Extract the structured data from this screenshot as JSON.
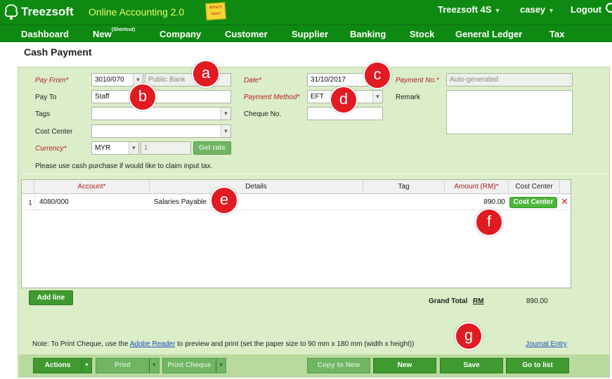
{
  "brand": {
    "logo_text": "Treezsoft",
    "app_name": "Online Accounting 2.0",
    "whats_new": "What's New!"
  },
  "user_menu": {
    "company": "Treezsoft 4S",
    "user": "casey",
    "logout": "Logout"
  },
  "nav": [
    {
      "label": "Dashboard"
    },
    {
      "label": "New",
      "sup": "(Shortcut)"
    },
    {
      "label": "Company"
    },
    {
      "label": "Customer"
    },
    {
      "label": "Supplier"
    },
    {
      "label": "Banking"
    },
    {
      "label": "Stock"
    },
    {
      "label": "General Ledger"
    },
    {
      "label": "Tax"
    }
  ],
  "page_title": "Cash Payment",
  "form": {
    "pay_from": {
      "label": "Pay From*",
      "code": "3010/070",
      "name": "Public Bank"
    },
    "pay_to": {
      "label": "Pay To",
      "value": "Staff"
    },
    "tags": {
      "label": "Tags",
      "value": ""
    },
    "cost_center": {
      "label": "Cost Center",
      "value": ""
    },
    "currency": {
      "label": "Currency*",
      "value": "MYR",
      "rate": "1",
      "get_rate": "Get rate"
    },
    "date": {
      "label": "Date*",
      "value": "31/10/2017"
    },
    "payment_method": {
      "label": "Payment Method*",
      "value": "EFT"
    },
    "cheque_no": {
      "label": "Cheque No.",
      "value": ""
    },
    "payment_no": {
      "label": "Payment No.*",
      "value": "Auto-generated"
    },
    "remark": {
      "label": "Remark",
      "value": ""
    },
    "note": "Please use cash purchase if would like to claim input tax."
  },
  "grid": {
    "headers": {
      "account": "Account*",
      "details": "Details",
      "tag": "Tag",
      "amount": "Amount (RM)*",
      "cost_center": "Cost Center"
    },
    "rows": [
      {
        "num": "1",
        "account": "4080/000",
        "details": "Salaries Payable",
        "tag": "",
        "amount": "890.00",
        "cost_center_btn": "Cost Center"
      }
    ]
  },
  "add_line": "Add line",
  "grand_total": {
    "label": "Grand Total",
    "currency": "RM",
    "value": "890.00"
  },
  "print_note": {
    "before": "Note: To Print Cheque, use the",
    "link": "Adobe Reader",
    "after": "to preview and print (set the paper size to 90 mm x 180 mm (width x height))"
  },
  "journal_entry": "Journal Entry",
  "bottom_buttons": {
    "actions": "Actions",
    "print": "Print",
    "print_cheque": "Print Cheque",
    "copy_to_new": "Copy to New",
    "new": "New",
    "save": "Save",
    "go_to_list": "Go to list"
  },
  "markers": {
    "a": "a",
    "b": "b",
    "c": "c",
    "d": "d",
    "e": "e",
    "f": "f",
    "g": "g"
  },
  "colors": {
    "nav_green": "#0e8a12",
    "panel_green": "#dcedc9",
    "button_green": "#3f9b2f",
    "required_red": "#b32020",
    "marker_red": "#e11b21"
  }
}
